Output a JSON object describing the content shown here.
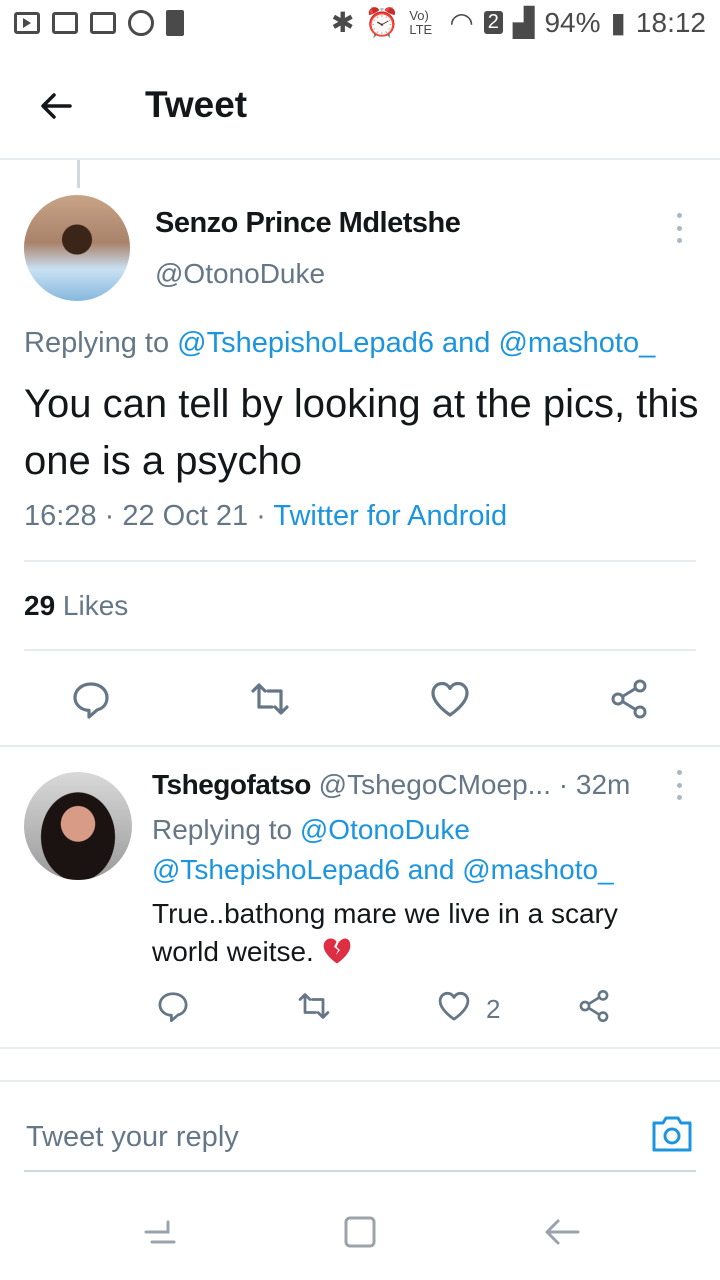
{
  "status_bar": {
    "battery": "94%",
    "time": "18:12",
    "volte": "Vo) LTE",
    "sim": "2"
  },
  "header": {
    "title": "Tweet"
  },
  "main_tweet": {
    "name": "Senzo Prince Mdletshe",
    "handle": "@OtonoDuke",
    "replying_prefix": "Replying to ",
    "replying_user1": "@TshepishoLepad6",
    "replying_and": " and ",
    "replying_user2": "@mashoto_",
    "text": "You can tell by looking at the pics, this one is a psycho",
    "time": "16:28",
    "sep": " · ",
    "date": "22 Oct 21",
    "client": "Twitter for Android",
    "likes_count": "29",
    "likes_label": " Likes"
  },
  "reply_tweet": {
    "name": "Tshegofatso",
    "handle": "@TshegoCMoep...",
    "time": "· 32m",
    "replying_prefix": "Replying to ",
    "replying_user1": "@OtonoDuke",
    "replying_user2": "@TshepishoLepad6",
    "replying_and": " and ",
    "replying_user3": "@mashoto_",
    "text": "True..bathong mare we live in a scary world weitse.",
    "like_count": "2"
  },
  "composer": {
    "placeholder": "Tweet your reply"
  },
  "colors": {
    "link": "#1b95e0",
    "secondary": "#657786",
    "icon": "#657786",
    "emoji": "#dd2e44"
  },
  "icons": [
    "back-arrow-icon",
    "more-vert-icon",
    "reply-icon",
    "retweet-icon",
    "like-icon",
    "share-icon",
    "camera-icon",
    "broken-heart-emoji",
    "recent-apps-icon",
    "home-icon",
    "nav-back-icon"
  ]
}
